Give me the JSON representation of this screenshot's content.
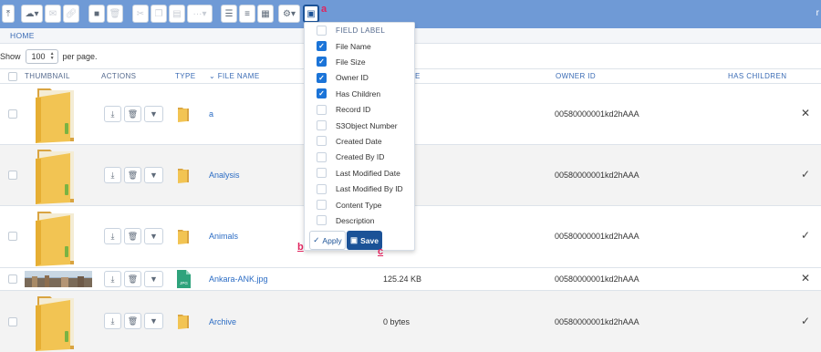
{
  "toolbar": {
    "user_initial": "r",
    "icons": [
      "upload-icon",
      "cloud-icon",
      "email-icon",
      "link-icon",
      "folder-icon",
      "trash-icon",
      "cut-icon",
      "copy-icon",
      "paste-icon",
      "more-icon",
      "list-view-icon",
      "detail-view-icon",
      "grid-view-icon",
      "gear-icon",
      "columns-icon"
    ]
  },
  "annotations": {
    "a": "a",
    "b": "b",
    "c": "c"
  },
  "breadcrumb": {
    "home": "HOME"
  },
  "paging": {
    "show_label": "Show",
    "per_page_value": "100",
    "per_page_label": "per page."
  },
  "table": {
    "headers": {
      "thumbnail": "THUMBNAIL",
      "actions": "ACTIONS",
      "type": "TYPE",
      "file_name": "FILE NAME",
      "size_fragment": "E",
      "owner_id": "OWNER ID",
      "has_children": "HAS CHILDREN"
    },
    "rows": [
      {
        "name": "a",
        "size": "",
        "owner": "00580000001kd2hAAA",
        "children": "✕"
      },
      {
        "name": "Analysis",
        "size": "",
        "owner": "00580000001kd2hAAA",
        "children": "✓"
      },
      {
        "name": "Animals",
        "size": "",
        "owner": "00580000001kd2hAAA",
        "children": "✓"
      },
      {
        "name": "Ankara-ANK.jpg",
        "size": "125.24 KB",
        "owner": "00580000001kd2hAAA",
        "children": "✕",
        "type_label": "JPG"
      },
      {
        "name": "Archive",
        "size": "0 bytes",
        "owner": "00580000001kd2hAAA",
        "children": "✓"
      }
    ]
  },
  "field_panel": {
    "header": "FIELD LABEL",
    "fields": [
      {
        "label": "File Name",
        "checked": true
      },
      {
        "label": "File Size",
        "checked": true
      },
      {
        "label": "Owner ID",
        "checked": true
      },
      {
        "label": "Has Children",
        "checked": true
      },
      {
        "label": "Record ID",
        "checked": false
      },
      {
        "label": "S3Object Number",
        "checked": false
      },
      {
        "label": "Created Date",
        "checked": false
      },
      {
        "label": "Created By ID",
        "checked": false
      },
      {
        "label": "Last Modified Date",
        "checked": false
      },
      {
        "label": "Last Modified By ID",
        "checked": false
      },
      {
        "label": "Content Type",
        "checked": false
      },
      {
        "label": "Description",
        "checked": false
      }
    ],
    "apply_label": "Apply",
    "save_label": "Save"
  },
  "colors": {
    "toolbar_bg": "#6f9ad6",
    "link": "#2b6cc4",
    "accent": "#1b5297",
    "checkbox_on": "#1b74d8",
    "annotation": "#e0245e"
  }
}
